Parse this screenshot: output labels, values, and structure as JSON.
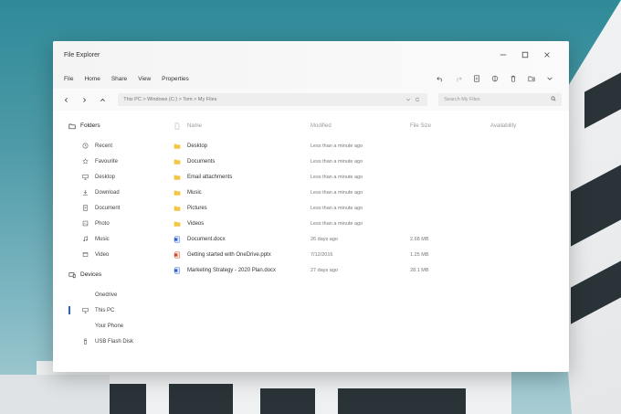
{
  "window": {
    "title": "File Explorer",
    "controls": [
      "minimize-icon",
      "maximize-icon",
      "close-icon"
    ]
  },
  "menu": [
    "File",
    "Home",
    "Share",
    "View",
    "Properties"
  ],
  "toolbar_icons": [
    "undo-icon",
    "redo-icon",
    "copy-icon",
    "share-icon",
    "delete-icon",
    "folder-move-icon",
    "chevron-down-icon"
  ],
  "address": {
    "path": "This PC  >  Windows (C:)  >  Tom  >  My Files"
  },
  "search": {
    "placeholder": "Search My Files"
  },
  "sidebar": {
    "folders_heading": "Folders",
    "folders": [
      {
        "label": "Recent",
        "icon": "clock-icon"
      },
      {
        "label": "Favourite",
        "icon": "star-icon"
      },
      {
        "label": "Desktop",
        "icon": "monitor-icon"
      },
      {
        "label": "Download",
        "icon": "download-icon"
      },
      {
        "label": "Document",
        "icon": "document-icon"
      },
      {
        "label": "Photo",
        "icon": "photo-icon"
      },
      {
        "label": "Music",
        "icon": "music-icon"
      },
      {
        "label": "Video",
        "icon": "video-icon"
      }
    ],
    "devices_heading": "Devices",
    "devices": [
      {
        "label": "Onedrive",
        "icon": "cloud-icon"
      },
      {
        "label": "This PC",
        "icon": "monitor-icon",
        "active": true
      },
      {
        "label": "Your Phone",
        "icon": "phone-icon"
      },
      {
        "label": "USB Flash Disk",
        "icon": "usb-icon"
      }
    ]
  },
  "table": {
    "headers": {
      "name": "Name",
      "modified": "Modified",
      "size": "File Size",
      "availability": "Availability"
    },
    "rows": [
      {
        "type": "folder",
        "name": "Desktop",
        "modified": "Less than a minute ago",
        "size": ""
      },
      {
        "type": "folder",
        "name": "Documents",
        "modified": "Less than a minute ago",
        "size": ""
      },
      {
        "type": "folder",
        "name": "Email attachments",
        "modified": "Less than a minute ago",
        "size": ""
      },
      {
        "type": "folder",
        "name": "Music",
        "modified": "Less than a minute ago",
        "size": ""
      },
      {
        "type": "folder",
        "name": "Pictures",
        "modified": "Less than a minute ago",
        "size": ""
      },
      {
        "type": "folder",
        "name": "Videos",
        "modified": "Less than a minute ago",
        "size": ""
      },
      {
        "type": "word",
        "name": "Document.docx",
        "modified": "26 days ago",
        "size": "2.68 MB"
      },
      {
        "type": "powerpoint",
        "name": "Getting started with OneDrive.pptx",
        "modified": "7/12/2016",
        "size": "1.25 MB"
      },
      {
        "type": "word",
        "name": "Marketing Strategy - 2020 Plan.docx",
        "modified": "27 days ago",
        "size": "28.1 MB"
      }
    ]
  },
  "colors": {
    "folder": "#f4c542",
    "word": "#2b5fd9",
    "powerpoint": "#d24726",
    "accent": "#2b5fd9"
  }
}
